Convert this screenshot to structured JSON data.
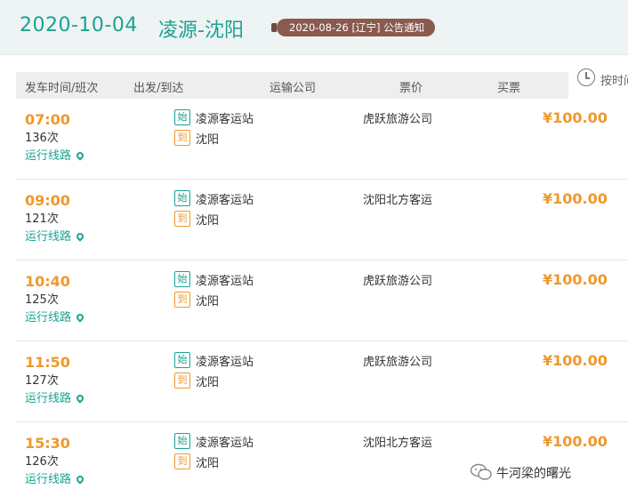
{
  "header": {
    "date": "2020-10-04",
    "route": "凌源-沈阳",
    "notice": "2020-08-26 [辽宁] 公告通知"
  },
  "table": {
    "columns": [
      "发车时间/班次",
      "出发/到达",
      "运输公司",
      "票价",
      "买票"
    ],
    "sort_label": "按时间"
  },
  "labels": {
    "start_tag": "始",
    "end_tag": "到",
    "route_link": "运行线路"
  },
  "trips": [
    {
      "time": "07:00",
      "number": "136次",
      "from": "凌源客运站",
      "to": "沈阳",
      "company": "虎跃旅游公司",
      "price": "¥100.00"
    },
    {
      "time": "09:00",
      "number": "121次",
      "from": "凌源客运站",
      "to": "沈阳",
      "company": "沈阳北方客运",
      "price": "¥100.00"
    },
    {
      "time": "10:40",
      "number": "125次",
      "from": "凌源客运站",
      "to": "沈阳",
      "company": "虎跃旅游公司",
      "price": "¥100.00"
    },
    {
      "time": "11:50",
      "number": "127次",
      "from": "凌源客运站",
      "to": "沈阳",
      "company": "虎跃旅游公司",
      "price": "¥100.00"
    },
    {
      "time": "15:30",
      "number": "126次",
      "from": "凌源客运站",
      "to": "沈阳",
      "company": "沈阳北方客运",
      "price": "¥100.00"
    }
  ],
  "watermark": "牛河梁的曙光",
  "colors": {
    "accent": "#1aa293",
    "price": "#f0982c",
    "notice_bg": "#8a5a4f"
  }
}
